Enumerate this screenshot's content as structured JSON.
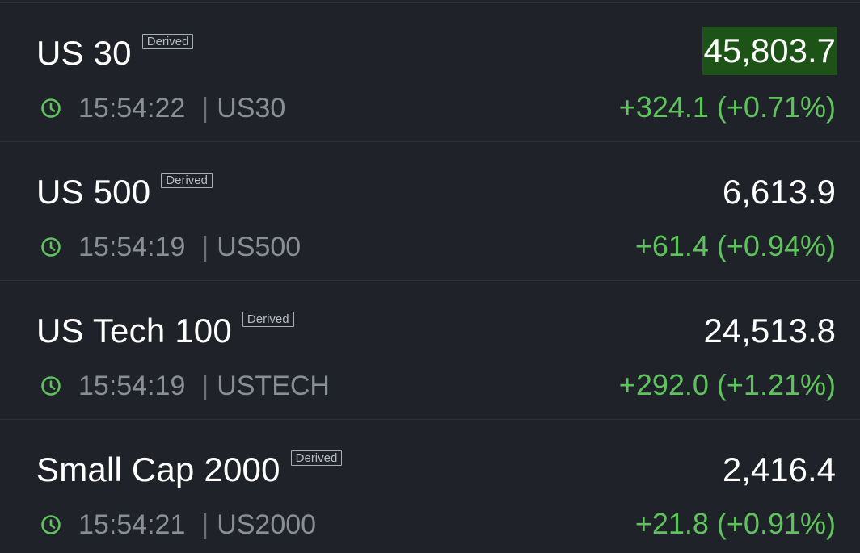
{
  "badge_label": "Derived",
  "colors": {
    "background": "#1f2228",
    "positive": "#5cc45a",
    "flash_highlight": "#1d5316",
    "clock_icon": "#5cc45a"
  },
  "instruments": [
    {
      "name": "US 30",
      "time": "15:54:22",
      "symbol": "US30",
      "price": "45,803.7",
      "change": "+324.1 (+0.71%)",
      "highlighted": true
    },
    {
      "name": "US 500",
      "time": "15:54:19",
      "symbol": "US500",
      "price": "6,613.9",
      "change": "+61.4 (+0.94%)",
      "highlighted": false
    },
    {
      "name": "US Tech 100",
      "time": "15:54:19",
      "symbol": "USTECH",
      "price": "24,513.8",
      "change": "+292.0 (+1.21%)",
      "highlighted": false
    },
    {
      "name": "Small Cap 2000",
      "time": "15:54:21",
      "symbol": "US2000",
      "price": "2,416.4",
      "change": "+21.8 (+0.91%)",
      "highlighted": false
    }
  ],
  "separator": "|",
  "clock_icon_name": "clock-icon"
}
